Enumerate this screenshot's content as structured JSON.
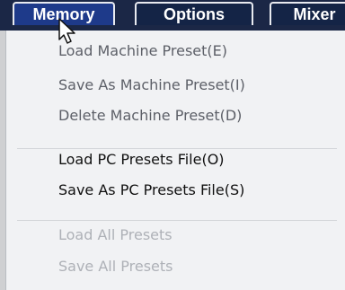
{
  "menubar": {
    "tabs": [
      {
        "label": "Memory"
      },
      {
        "label": "Options"
      },
      {
        "label": "Mixer"
      }
    ]
  },
  "dropdown": {
    "items": [
      {
        "label": "Load Machine Preset(E)"
      },
      {
        "label": "Save As Machine Preset(I)"
      },
      {
        "label": "Delete Machine Preset(D)"
      },
      {
        "label": "Load PC Presets File(O)"
      },
      {
        "label": "Save As PC Presets File(S)"
      },
      {
        "label": "Load All Presets"
      },
      {
        "label": "Save All Presets"
      }
    ]
  },
  "icons": {
    "cursor": "mouse-pointer-icon"
  }
}
